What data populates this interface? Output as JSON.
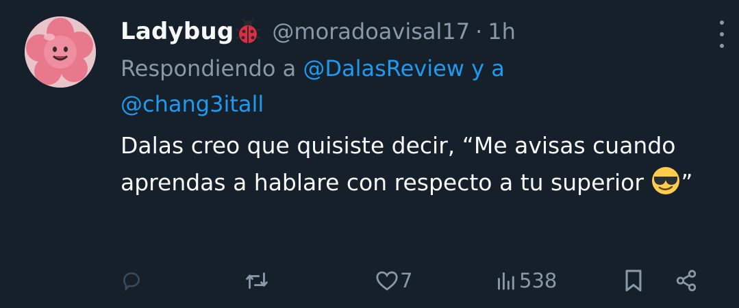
{
  "tweet": {
    "display_name": "Ladybug",
    "name_emoji_icon": "ladybug-icon",
    "handle": "@moradoavisal17",
    "separator": "·",
    "time": "1h",
    "reply_prefix": "Respondiendo a",
    "reply_mention_1": "@DalasReview",
    "reply_conjunction": "y a",
    "reply_mention_2": "@chang3itall",
    "text_part_1": "Dalas creo que quisiste decir, “Me avisas cuando aprendas a hablare con respecto a tu superior",
    "text_emoji_icon": "smiling-face-with-sunglasses-icon",
    "text_part_2": "”"
  },
  "actions": {
    "reply_icon": "reply-icon",
    "retweet_icon": "retweet-icon",
    "like_icon": "heart-icon",
    "like_count": "7",
    "views_icon": "views-icon",
    "views_count": "538",
    "bookmark_icon": "bookmark-icon",
    "share_icon": "share-icon"
  },
  "colors": {
    "background": "#15202b",
    "primary_text": "#f7f9f9",
    "secondary_text": "#8b98a5",
    "link": "#1d9bf0"
  }
}
